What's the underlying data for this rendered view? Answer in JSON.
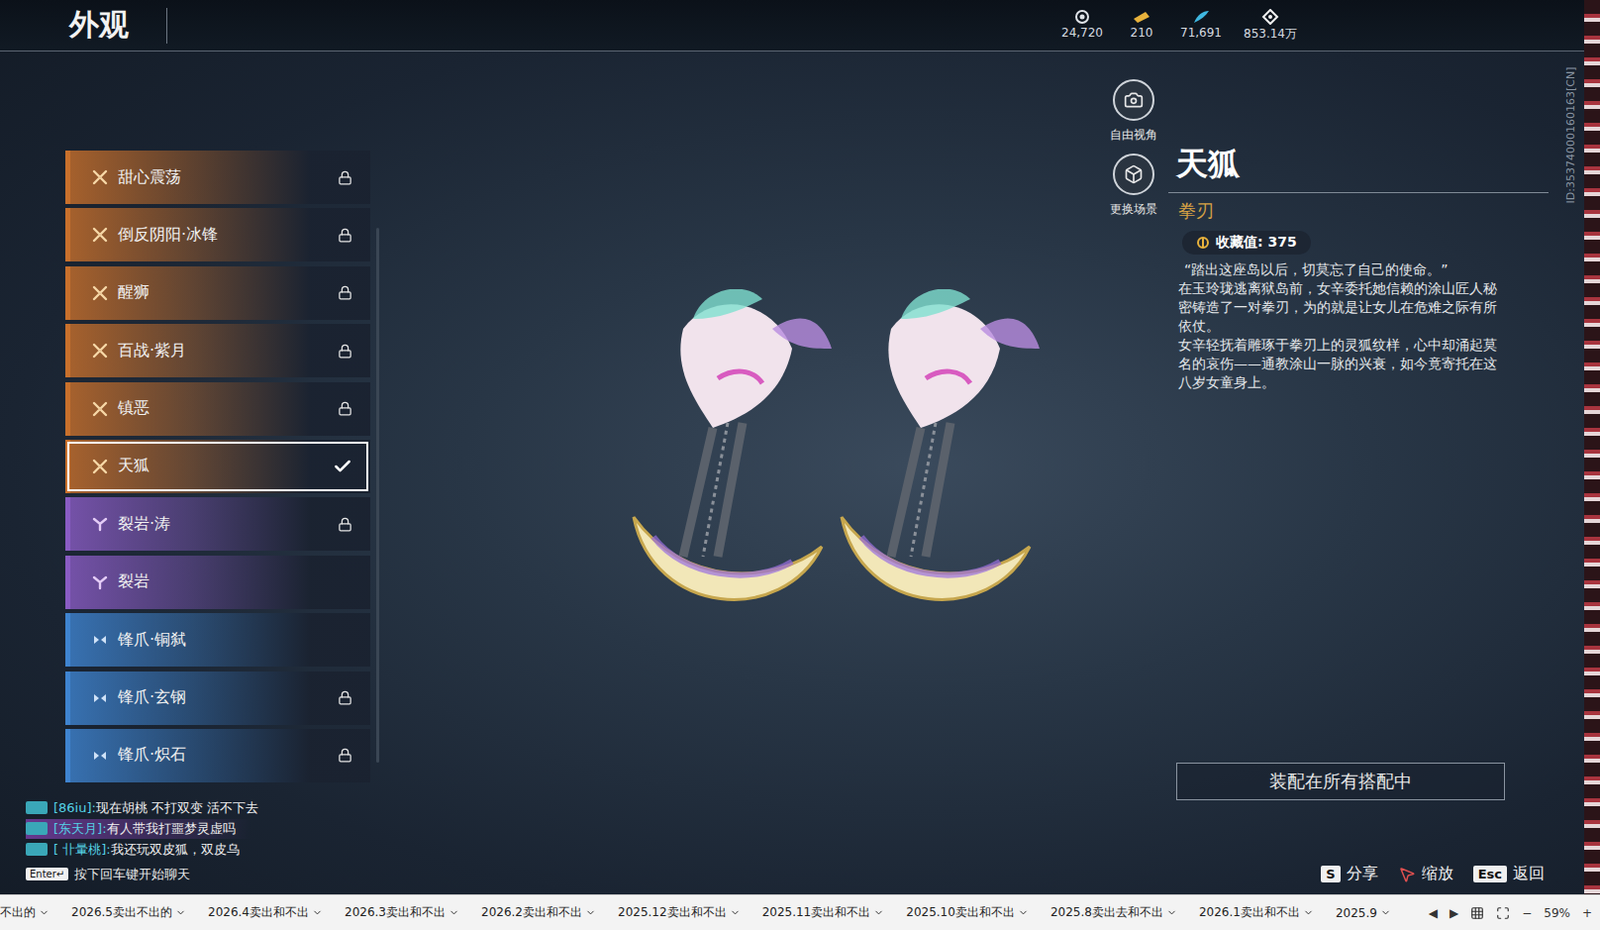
{
  "window": {
    "title": "外观",
    "id_label": "ID:35374000160163[CN]"
  },
  "currencies": [
    {
      "value": "24,720"
    },
    {
      "value": "210"
    },
    {
      "value": "71,691"
    },
    {
      "value": "853.14万"
    }
  ],
  "skins": [
    {
      "label": "甜心震荡",
      "kind": "legendary",
      "color": "#c8702c",
      "locked": true,
      "selected": false
    },
    {
      "label": "倒反阴阳·冰锋",
      "kind": "legendary",
      "color": "#c8702c",
      "locked": true,
      "selected": false
    },
    {
      "label": "醒狮",
      "kind": "legendary",
      "color": "#c8702c",
      "locked": true,
      "selected": false
    },
    {
      "label": "百战·紫月",
      "kind": "legendary",
      "color": "#c8702c",
      "locked": true,
      "selected": false
    },
    {
      "label": "镇恶",
      "kind": "legendary",
      "color": "#c8702c",
      "locked": true,
      "selected": false
    },
    {
      "label": "天狐",
      "kind": "legendary",
      "color": "#c8702c",
      "locked": false,
      "selected": true
    },
    {
      "label": "裂岩·涛",
      "kind": "epic",
      "color": "#8a5cc4",
      "locked": true,
      "selected": false
    },
    {
      "label": "裂岩",
      "kind": "epic",
      "color": "#8a5cc4",
      "locked": false,
      "selected": false
    },
    {
      "label": "锋爪·铜弑",
      "kind": "rare",
      "color": "#3f84d0",
      "locked": false,
      "selected": false
    },
    {
      "label": "锋爪·玄钢",
      "kind": "rare",
      "color": "#3f84d0",
      "locked": true,
      "selected": false
    },
    {
      "label": "锋爪·炽石",
      "kind": "rare",
      "color": "#3f84d0",
      "locked": true,
      "selected": false
    }
  ],
  "view_buttons": [
    {
      "label": "自由视角",
      "kind": "camera"
    },
    {
      "label": "更换场景",
      "kind": "scene"
    }
  ],
  "detail": {
    "name": "天狐",
    "type": "拳刃",
    "collection": "收藏值: 375",
    "quote": "“踏出这座岛以后，切莫忘了自己的使命。”",
    "paragraphs": [
      "在玉玲珑逃离狱岛前，女辛委托她信赖的涂山匠人秘密铸造了一对拳刃，为的就是让女儿在危难之际有所依仗。",
      "女辛轻抚着雕琢于拳刃上的灵狐纹样，心中却涌起莫名的哀伤——通教涂山一脉的兴衰，如今竟寄托在这八岁女童身上。"
    ],
    "equip_button": "装配在所有搭配中"
  },
  "chat": {
    "messages": [
      {
        "name": "[86iu]:",
        "text": "现在胡桃 不打双变  活不下去",
        "highlight": false
      },
      {
        "name": "[东天月]:",
        "text": "有人带我打噩梦灵虚吗",
        "highlight": true
      },
      {
        "name": "[ 卝暈桃]:",
        "text": "我还玩双皮狐，双皮乌",
        "highlight": false
      }
    ],
    "enter_key": "Enter↵",
    "hint": "按下回车键开始聊天"
  },
  "hints": [
    {
      "key": "S",
      "label": "分享",
      "kind": "key"
    },
    {
      "key": "",
      "label": "缩放",
      "kind": "mouse"
    },
    {
      "key": "Esc",
      "label": "返回",
      "kind": "key"
    }
  ],
  "sheet_bar": {
    "tabs": [
      "不出的",
      "2026.5卖出不出的",
      "2026.4卖出和不出",
      "2026.3卖出和不出",
      "2026.2卖出和不出",
      "2025.12卖出和不出",
      "2025.11卖出和不出",
      "2025.10卖出和不出",
      "2025.8卖出去和不出",
      "2026.1卖出和不出",
      "2025.9"
    ],
    "prev": "◀",
    "next": "▶",
    "zoom_out": "−",
    "zoom": "59%",
    "zoom_in": "+"
  }
}
